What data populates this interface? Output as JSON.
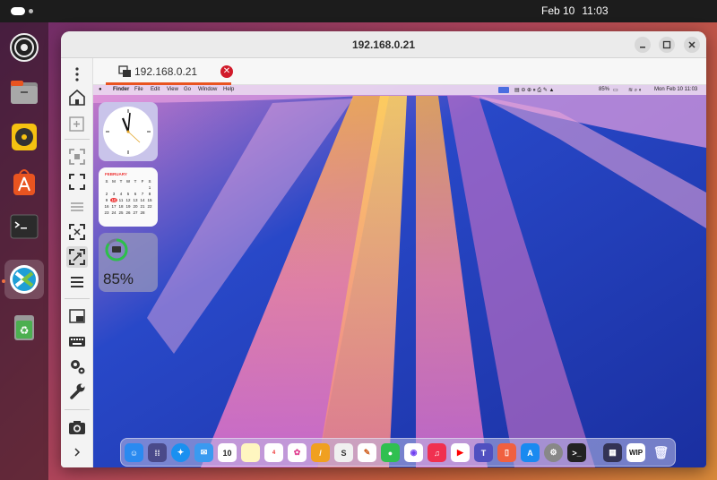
{
  "topbar": {
    "date": "Feb 10",
    "time": "11:03"
  },
  "ubuntu_dock": {
    "items": [
      {
        "name": "disk-icon",
        "color": "#202020"
      },
      {
        "name": "files-icon",
        "color": "#9a9a9a"
      },
      {
        "name": "rhythmbox-icon",
        "color": "#f5c211"
      },
      {
        "name": "app-center-icon",
        "color": "#e95420"
      },
      {
        "name": "terminal-icon",
        "color": "#2b2b2b"
      },
      {
        "name": "remmina-icon",
        "color": "#1f9ed6"
      },
      {
        "name": "trash-icon",
        "color": "#4caf50"
      }
    ]
  },
  "window": {
    "title": "192.168.0.21",
    "tab": {
      "label": "192.168.0.21"
    }
  },
  "remote": {
    "menubar": {
      "items": [
        "Finder",
        "File",
        "Edit",
        "View",
        "Go",
        "Window",
        "Help"
      ],
      "battery": "85%",
      "datetime": "Mon Feb 10  11:03"
    },
    "calendar": {
      "month": "FEBRUARY",
      "weekdays": [
        "S",
        "M",
        "T",
        "W",
        "T",
        "F",
        "S"
      ],
      "days": [
        "",
        "",
        "",
        "",
        "",
        "",
        "1",
        "2",
        "3",
        "4",
        "5",
        "6",
        "7",
        "8",
        "9",
        "10",
        "11",
        "12",
        "13",
        "14",
        "15",
        "16",
        "17",
        "18",
        "19",
        "20",
        "21",
        "22",
        "23",
        "24",
        "25",
        "26",
        "27",
        "28",
        ""
      ],
      "today": "10"
    },
    "battery_widget": {
      "percent": "85%"
    },
    "dock_badges": {
      "calendar_day": "10",
      "reminders_badge": "4",
      "wip": "WIP"
    }
  },
  "colors": {
    "accent": "#e95420",
    "close": "#d11a2a"
  }
}
